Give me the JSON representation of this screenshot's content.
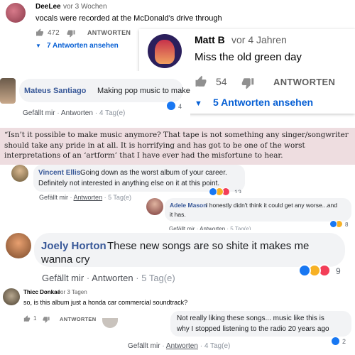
{
  "c1": {
    "author": "DeeLee",
    "time": "vor 3 Wochen",
    "text": "vocals were recorded at the McDonald's drive through",
    "likes": "472",
    "reply_label": "ANTWORTEN",
    "replies_label": "7 Antworten ansehen"
  },
  "c2": {
    "author": "Matt B",
    "time": "vor 4 Jahren",
    "text": "Miss the old green day",
    "likes": "54",
    "reply_label": "ANTWORTEN",
    "replies_label": "5 Antworten ansehen"
  },
  "c3": {
    "author": "Mateus Santiago",
    "text": "Making pop music to make money",
    "like": "Gefällt mir",
    "reply": "Antworten",
    "time": "4 Tag(e)",
    "count": "4"
  },
  "quote": {
    "text": "“Isn’t it possible to make music anymore? That tape is not something any singer/songwriter should take any pride in at all. It is horrifying and has got to be one of the worst interpretations of an ‘artform’ that I have ever had the misfortune to hear."
  },
  "c4": {
    "author": "Vincent Ellis",
    "line1": "Going down as the worst album of your career.",
    "line2": "Definitely not interested in anything else on it at this point.",
    "like": "Gefällt mir",
    "reply": "Antworten",
    "time": "5 Tag(e)",
    "count": "13"
  },
  "c5": {
    "author": "Adele Mason",
    "line1": "I honestly didn't think it could get any worse...and",
    "line2": "it has.",
    "like": "Gefällt mir",
    "reply": "Antworten",
    "time": "5 Tag(e)",
    "count": "8"
  },
  "c6": {
    "author": "Joely Horton",
    "line1": "These new songs are so shite it makes me",
    "line2": "wanna cry",
    "like": "Gefällt mir",
    "reply": "Antworten",
    "time": "5 Tag(e)",
    "count": "9"
  },
  "c7": {
    "author": "Thicc Donkaé",
    "time": "vor 3 Tagen",
    "text": "so, is this album just a honda car commercial soundtrack?",
    "likes": "1",
    "reply_label": "ANTWORTEN"
  },
  "c8": {
    "line1": "Not really liking these songs... music like this is",
    "line2": "why I stopped listening to the radio 20 years ago",
    "like": "Gefällt mir",
    "reply": "Antworten",
    "time": "4 Tag(e)",
    "count": "2"
  },
  "colors": {
    "fb_blue": "#385898",
    "yt_blue": "#065fd4",
    "like_blue": "#1877f2",
    "haha_yellow": "#f7b125",
    "angry_red": "#e9710f",
    "love_red": "#f33e58",
    "quote_bg": "#eedde0"
  },
  "icons": [
    "thumb-up-icon",
    "thumb-down-icon",
    "chevron-down-icon",
    "like-reaction-icon",
    "haha-reaction-icon",
    "love-reaction-icon",
    "angry-reaction-icon"
  ]
}
